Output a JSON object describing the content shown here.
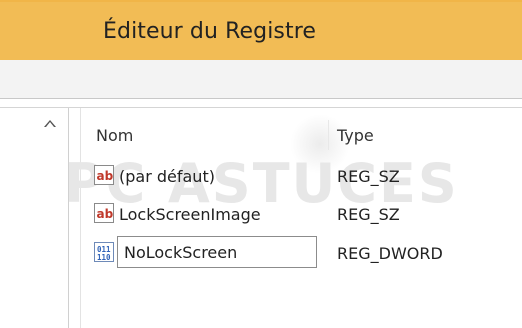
{
  "window": {
    "title": "Éditeur du Registre"
  },
  "watermark": "PC ASTUCES",
  "list": {
    "columns": {
      "name": "Nom",
      "type": "Type"
    },
    "rows": [
      {
        "icon": "string-value-icon",
        "name": "(par défaut)",
        "type": "REG_SZ"
      },
      {
        "icon": "string-value-icon",
        "name": "LockScreenImage",
        "type": "REG_SZ"
      },
      {
        "icon": "binary-value-icon",
        "name": "NoLockScreen",
        "type": "REG_DWORD",
        "editing": true
      }
    ]
  },
  "colors": {
    "titlebar": "#f2bc55",
    "menubar": "#f3f3f3",
    "ab_icon_red": "#c0392b",
    "bin_icon_blue": "#2f62b8"
  }
}
